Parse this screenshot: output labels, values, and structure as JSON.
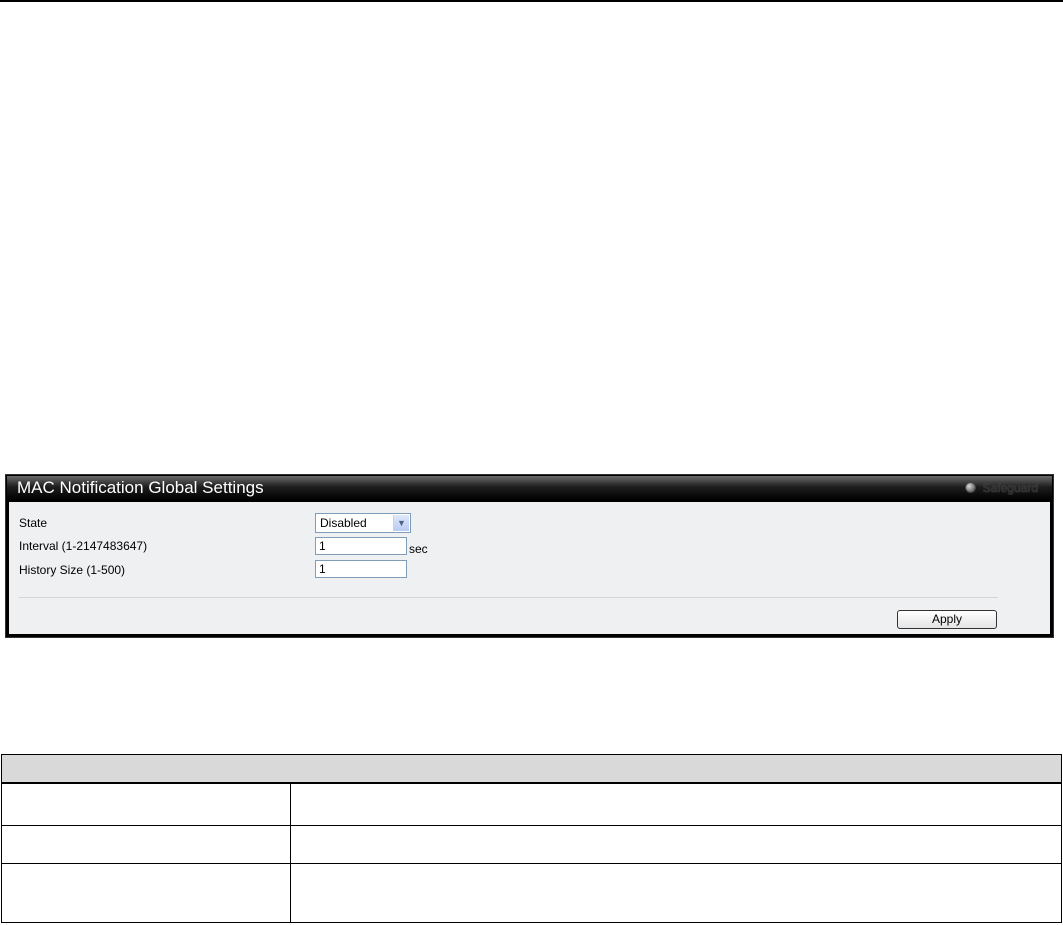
{
  "panel": {
    "title": "MAC Notification Global Settings",
    "safeguard_label": "Safeguard"
  },
  "form": {
    "state": {
      "label": "State",
      "value": "Disabled"
    },
    "interval": {
      "label": "Interval (1-2147483647)",
      "value": "1",
      "unit": "sec"
    },
    "history_size": {
      "label": "History Size (1-500)",
      "value": "1"
    },
    "apply_label": "Apply"
  },
  "table": {
    "header": "",
    "rows": [
      {
        "parameter": "",
        "description": ""
      },
      {
        "parameter": "",
        "description": ""
      },
      {
        "parameter": "",
        "description": ""
      }
    ]
  }
}
